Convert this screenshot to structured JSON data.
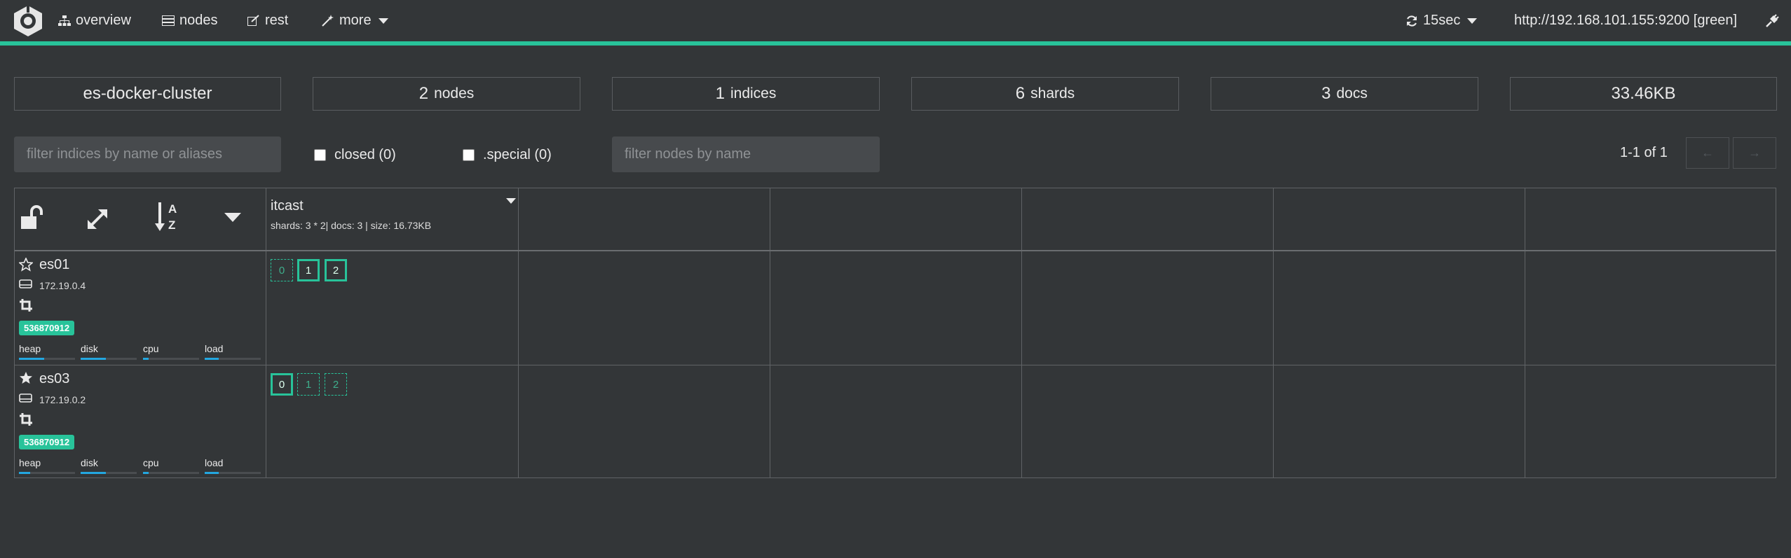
{
  "nav": {
    "items": [
      {
        "label": "overview",
        "icon": "sitemap-icon"
      },
      {
        "label": "nodes",
        "icon": "server-icon"
      },
      {
        "label": "rest",
        "icon": "edit-icon"
      },
      {
        "label": "more",
        "icon": "magic-wand-icon"
      }
    ],
    "refresh": "15sec",
    "host": "http://192.168.101.155:9200 [green]",
    "status_color": "#28c39a"
  },
  "summary": {
    "cluster_name": "es-docker-cluster",
    "nodes_count": "2",
    "nodes_label": "nodes",
    "indices_count": "1",
    "indices_label": "indices",
    "shards_count": "6",
    "shards_label": "shards",
    "docs_count": "3",
    "docs_label": "docs",
    "size": "33.46KB"
  },
  "filters": {
    "indices_placeholder": "filter indices by name or aliases",
    "closed_label": "closed (0)",
    "special_label": ".special (0)",
    "nodes_placeholder": "filter nodes by name",
    "pagination": "1-1 of 1"
  },
  "index": {
    "name": "itcast",
    "meta": "shards: 3 * 2| docs: 3 | size: 16.73KB"
  },
  "nodes": [
    {
      "name": "es01",
      "ip": "172.19.0.4",
      "badge": "536870912",
      "master": false,
      "metrics": {
        "heap": "heap",
        "disk": "disk",
        "cpu": "cpu",
        "load": "load"
      },
      "levels": {
        "heap": 0.45,
        "disk": 0.45,
        "cpu": 0.1,
        "load": 0.25
      },
      "shards": [
        {
          "num": "0",
          "primary": false
        },
        {
          "num": "1",
          "primary": true
        },
        {
          "num": "2",
          "primary": true
        }
      ]
    },
    {
      "name": "es03",
      "ip": "172.19.0.2",
      "badge": "536870912",
      "master": true,
      "metrics": {
        "heap": "heap",
        "disk": "disk",
        "cpu": "cpu",
        "load": "load"
      },
      "levels": {
        "heap": 0.2,
        "disk": 0.45,
        "cpu": 0.1,
        "load": 0.25
      },
      "shards": [
        {
          "num": "0",
          "primary": true
        },
        {
          "num": "1",
          "primary": false
        },
        {
          "num": "2",
          "primary": false
        }
      ]
    }
  ]
}
